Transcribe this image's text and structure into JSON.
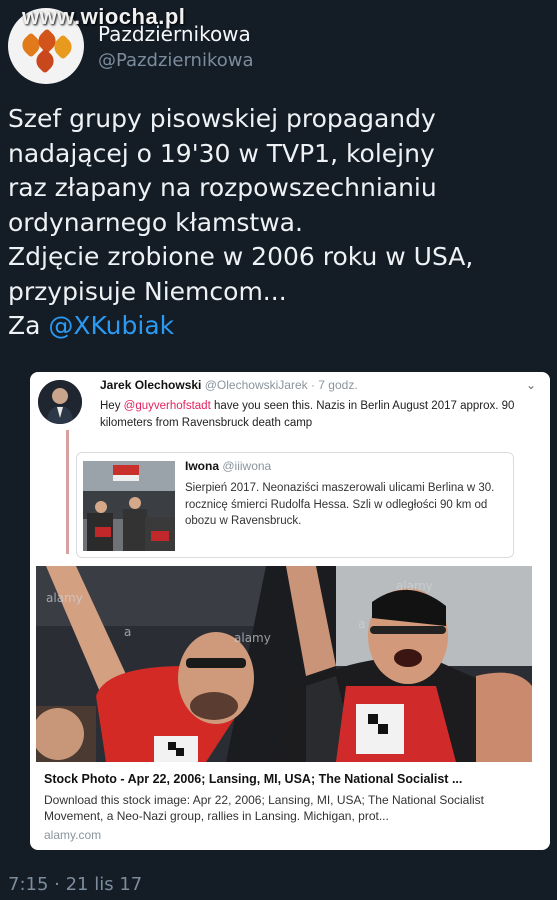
{
  "watermark": "www.wiocha.pl",
  "author": {
    "display_name": "Pazdziernikowa",
    "handle": "@Pazdziernikowa"
  },
  "tweet": {
    "lines": [
      "Szef grupy pisowskiej propagandy",
      "nadającej o 19'30 w TVP1, kolejny",
      "raz złapany na rozpowszechnianiu",
      "ordynarnego kłamstwa.",
      "Zdjęcie zrobione w 2006 roku w USA,",
      "przypisuje Niemcom...",
      "Za"
    ],
    "mention": "@XKubiak"
  },
  "quoted": {
    "name": "Jarek Olechowski",
    "handle": "@OlechowskiJarek",
    "time": "· 7 godz.",
    "text_before": "Hey ",
    "mention": "@guyverhofstadt",
    "text_after": " have you seen this. Nazis in Berlin August 2017 approx. 90 kilometers from Ravensbruck death camp",
    "inner": {
      "name": "Iwona",
      "handle": "@iiiwona",
      "text": "Sierpień 2017. Neonaziści maszerowali ulicami Berlina w 30. rocznicę śmierci Rudolfa Hessa. Szli w odległości  90 km od obozu w Ravensbruck."
    },
    "photo_watermarks": [
      "alamy",
      "a",
      "alamy",
      "a",
      "alamy"
    ],
    "link": {
      "title": "Stock Photo - Apr 22, 2006; Lansing, MI, USA; The National Socialist ...",
      "description": "Download this stock image: Apr 22, 2006; Lansing, MI, USA; The National Socialist Movement, a Neo-Nazi group, rallies in Lansing. Michigan, prot...",
      "domain": "alamy.com"
    }
  },
  "timestamp": "7:15 · 21 lis 17",
  "colors": {
    "background": "#141c26",
    "link": "#2b9af3",
    "mention_red": "#e0245e",
    "muted": "#7b8c9c"
  }
}
